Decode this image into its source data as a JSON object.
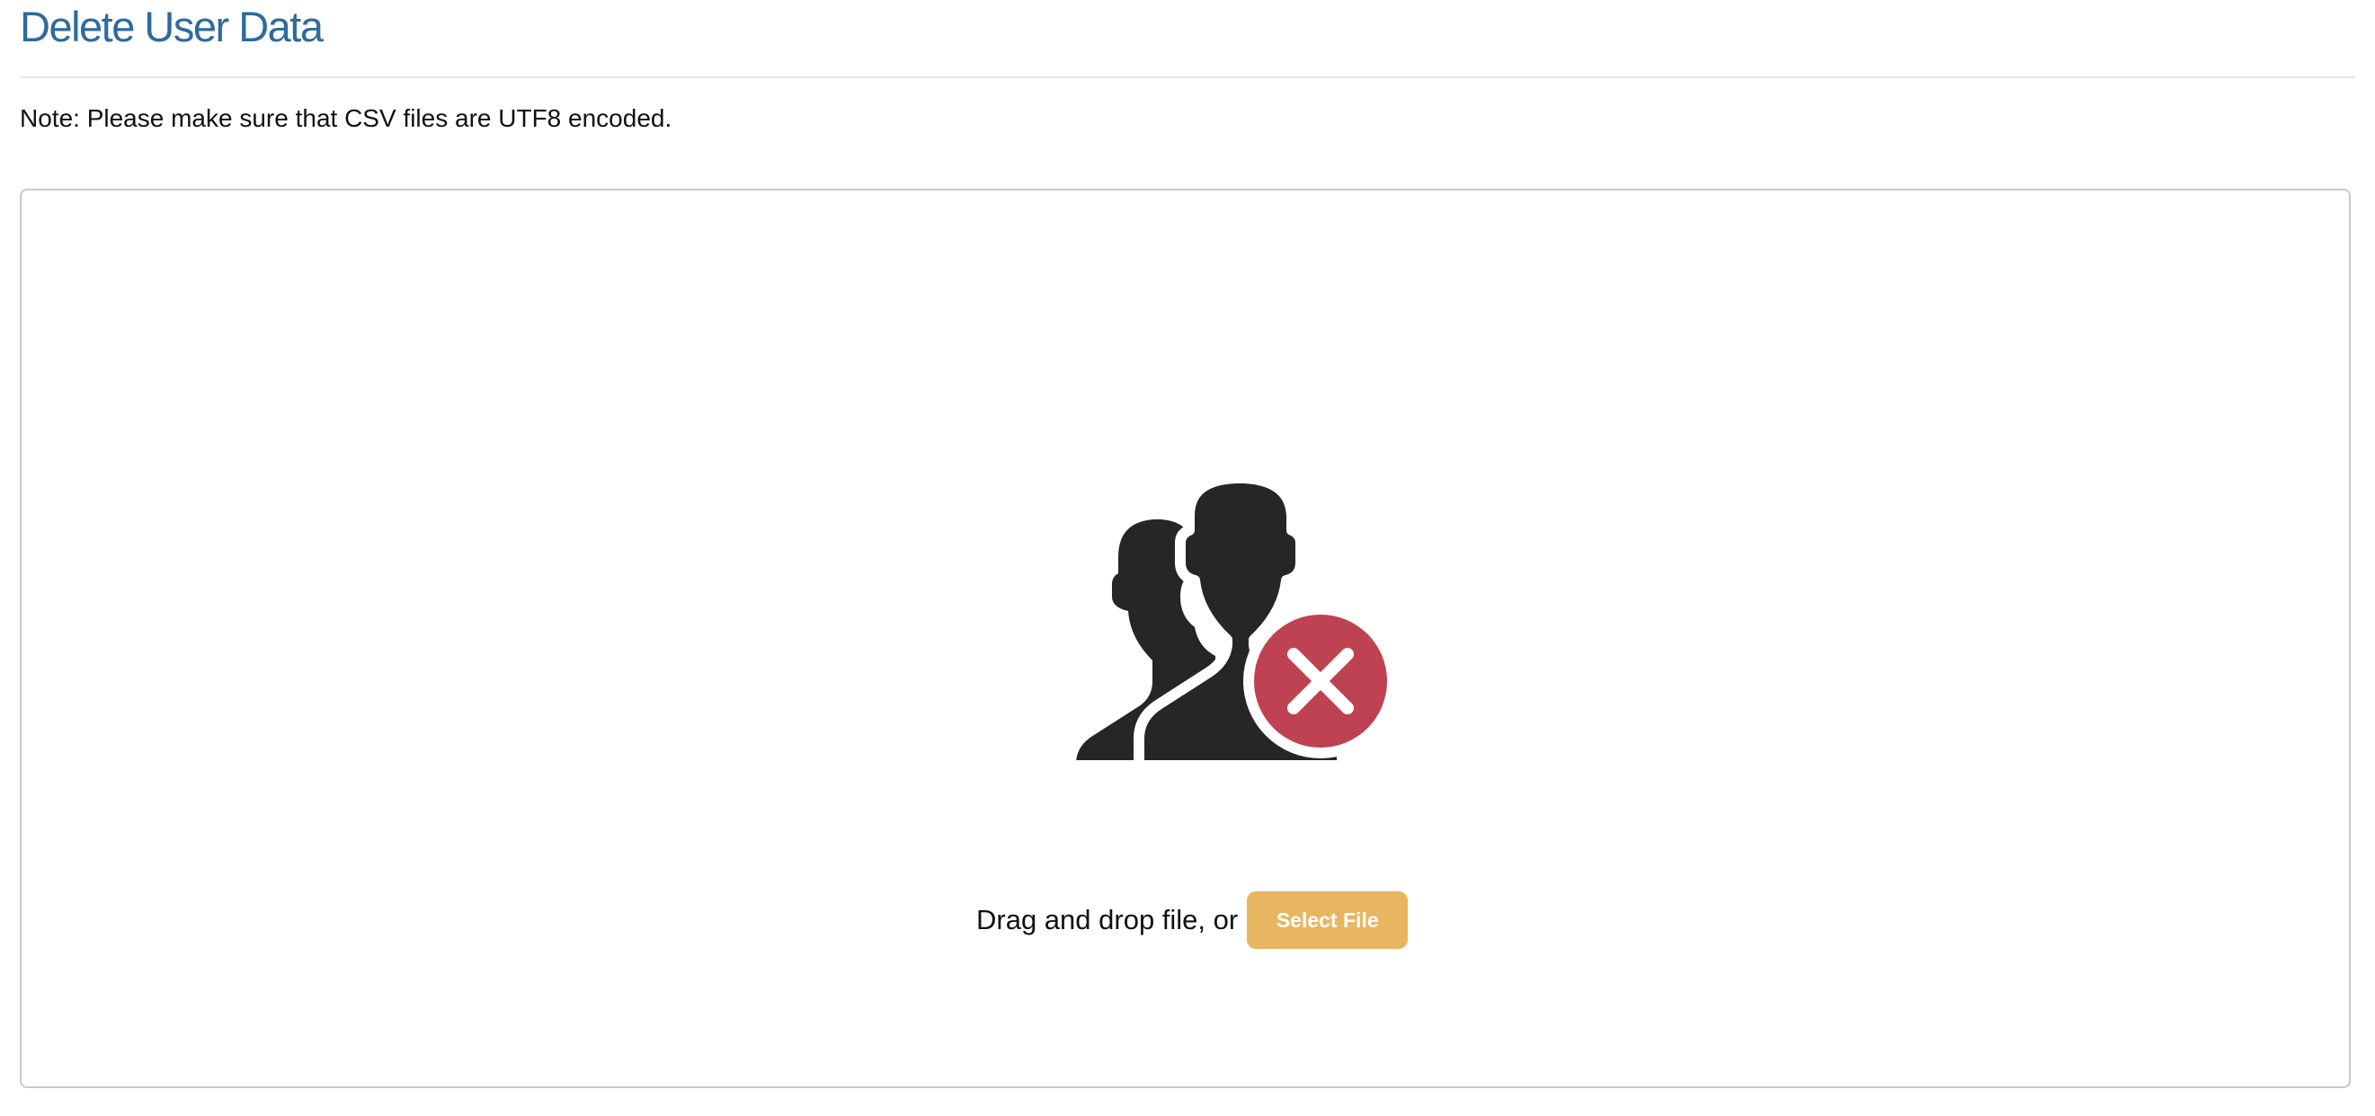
{
  "page": {
    "title": "Delete User Data",
    "note": "Note: Please make sure that CSV files are UTF8 encoded."
  },
  "dropzone": {
    "icon": "users-delete-icon",
    "instruction": "Drag and drop file, or",
    "select_button_label": "Select File"
  },
  "colors": {
    "title": "#2e6a9e",
    "silhouette": "#262626",
    "delete_badge": "#bf4252",
    "select_button": "#e8b660",
    "dropzone_border": "#c9c9c9"
  }
}
